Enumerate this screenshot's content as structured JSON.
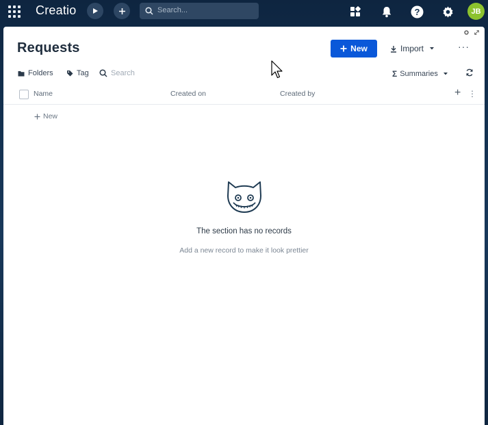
{
  "topbar": {
    "logo": "Creatio",
    "search_placeholder": "Search...",
    "avatar_initials": "JB",
    "avatar_color": "#8cc22e"
  },
  "page": {
    "title": "Requests",
    "new_button": "New",
    "import_button": "Import",
    "more": "···"
  },
  "toolbar": {
    "folders": "Folders",
    "tag": "Tag",
    "search_placeholder": "Search",
    "summaries": "Summaries"
  },
  "table": {
    "columns": [
      "Name",
      "Created on",
      "Created by"
    ],
    "add_new": "New"
  },
  "empty_state": {
    "title": "The section has no records",
    "subtitle": "Add a new record to make it look prettier"
  },
  "colors": {
    "accent": "#0a58d9",
    "background": "#13304f"
  }
}
